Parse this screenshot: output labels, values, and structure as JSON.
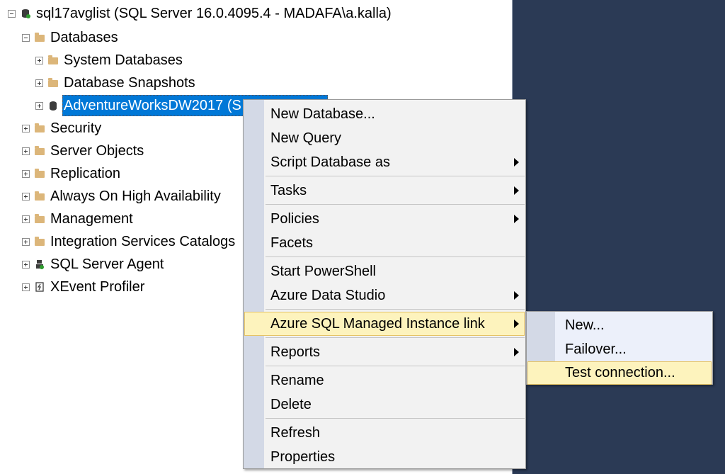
{
  "tree": {
    "server": "sql17avglist (SQL Server 16.0.4095.4 - MADAFA\\a.kalla)",
    "databases": "Databases",
    "system_databases": "System Databases",
    "database_snapshots": "Database Snapshots",
    "adventureworks": "AdventureWorksDW2017 (S",
    "security": "Security",
    "server_objects": "Server Objects",
    "replication": "Replication",
    "always_on": "Always On High Availability",
    "management": "Management",
    "integration_services": "Integration Services Catalogs",
    "sql_server_agent": "SQL Server Agent",
    "xevent_profiler": "XEvent Profiler"
  },
  "context_menu": {
    "new_database": "New Database...",
    "new_query": "New Query",
    "script_database_as": "Script Database as",
    "tasks": "Tasks",
    "policies": "Policies",
    "facets": "Facets",
    "start_powershell": "Start PowerShell",
    "azure_data_studio": "Azure Data Studio",
    "azure_sql_mi_link": "Azure SQL Managed Instance link",
    "reports": "Reports",
    "rename": "Rename",
    "delete": "Delete",
    "refresh": "Refresh",
    "properties": "Properties"
  },
  "submenu": {
    "new": "New...",
    "failover": "Failover...",
    "test_connection": "Test connection..."
  },
  "colors": {
    "desktop_background": "#2b3a55",
    "selection": "#0078d7",
    "menu_highlight": "#fdf3bd",
    "menu_gutter": "#d3d9e6",
    "folder": "#dcb67a"
  },
  "icons": {
    "server": "server-icon",
    "folder": "folder-icon",
    "database": "database-icon",
    "agent": "sql-agent-icon",
    "xevent": "xevent-profiler-icon",
    "submenu_arrow": "chevron-right-icon"
  }
}
